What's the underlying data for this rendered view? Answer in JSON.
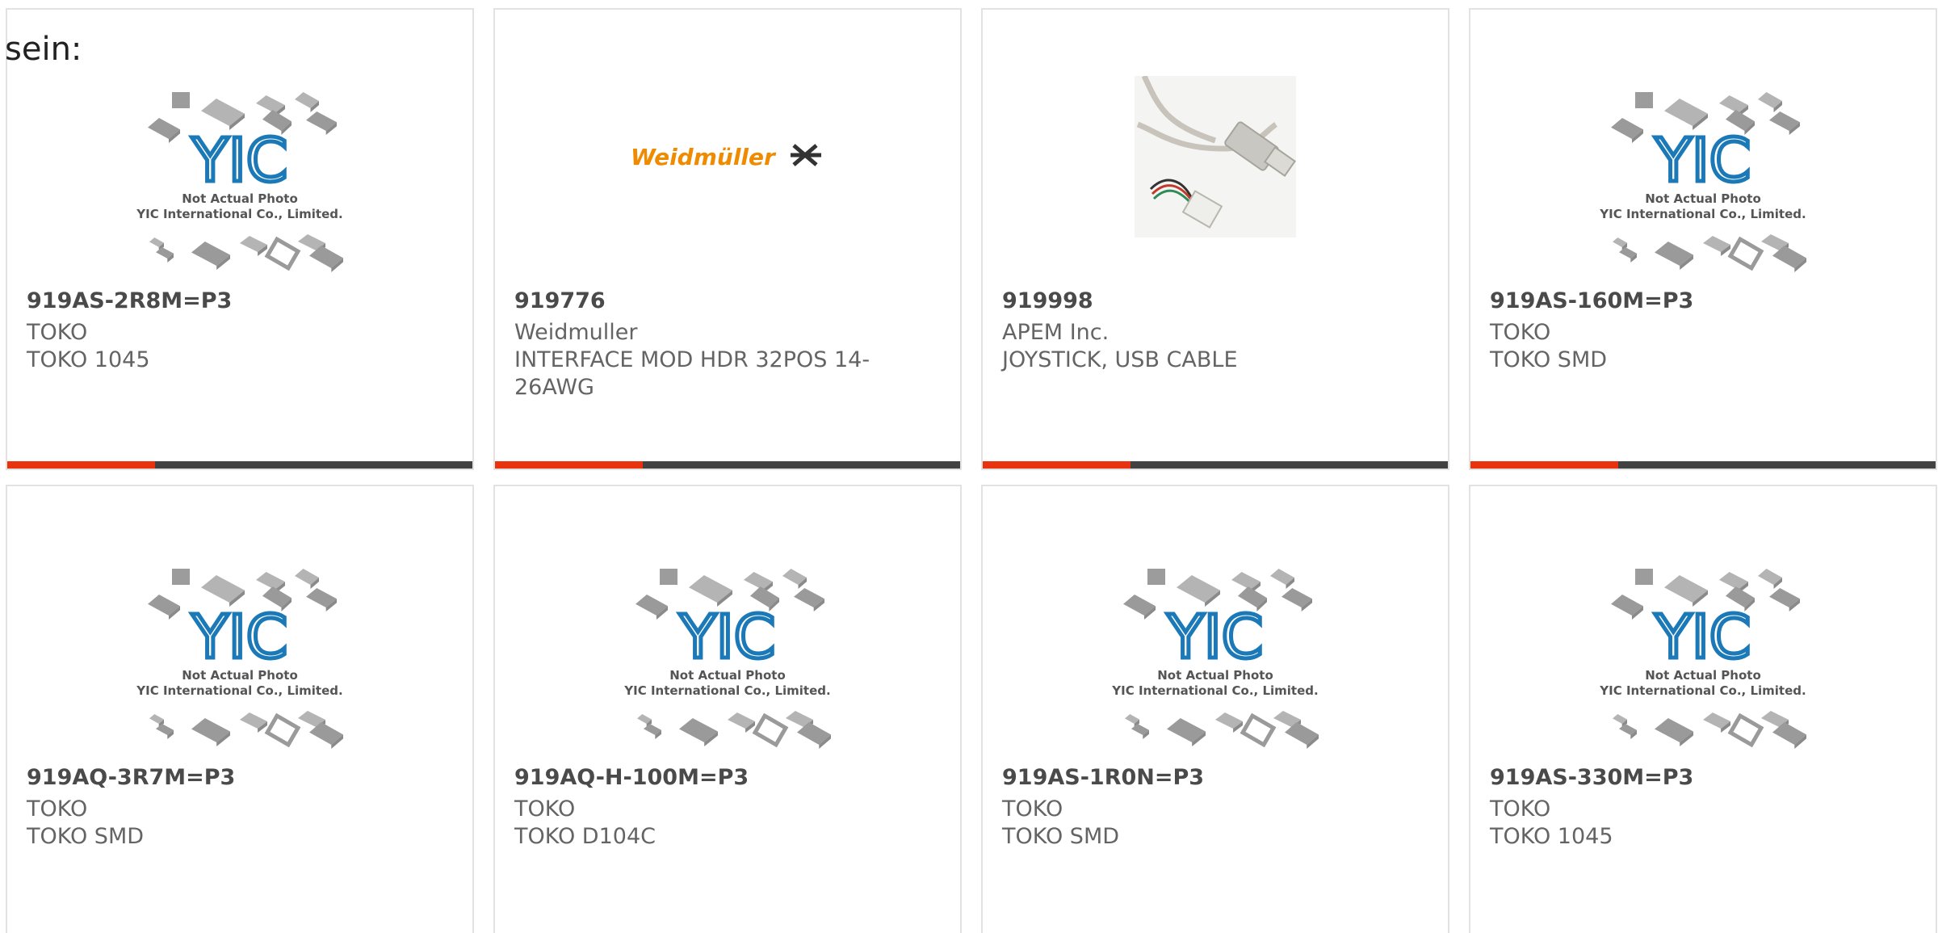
{
  "header_fragment": "sein:",
  "placeholder": {
    "brand": "YIC",
    "line1": "Not Actual Photo",
    "line2": "YIC International Co., Limited."
  },
  "weidmuller_logo_text": "Weidmüller",
  "colors": {
    "accent": "#e8330e",
    "bar": "#424242",
    "yic_blue": "#1b79b8",
    "weidmuller_orange": "#f08b00"
  },
  "products": [
    {
      "part": "919AS-2R8M=P3",
      "maker": "TOKO",
      "desc": "TOKO 1045",
      "image": "yic-placeholder"
    },
    {
      "part": "919776",
      "maker": "Weidmuller",
      "desc": "INTERFACE MOD HDR 32POS 14-26AWG",
      "image": "weidmuller-logo"
    },
    {
      "part": "919998",
      "maker": "APEM Inc.",
      "desc": "JOYSTICK, USB CABLE",
      "image": "usb-cable-photo"
    },
    {
      "part": "919AS-160M=P3",
      "maker": "TOKO",
      "desc": "TOKO SMD",
      "image": "yic-placeholder"
    },
    {
      "part": "919AQ-3R7M=P3",
      "maker": "TOKO",
      "desc": "TOKO SMD",
      "image": "yic-placeholder"
    },
    {
      "part": "919AQ-H-100M=P3",
      "maker": "TOKO",
      "desc": "TOKO D104C",
      "image": "yic-placeholder"
    },
    {
      "part": "919AS-1R0N=P3",
      "maker": "TOKO",
      "desc": "TOKO SMD",
      "image": "yic-placeholder"
    },
    {
      "part": "919AS-330M=P3",
      "maker": "TOKO",
      "desc": "TOKO 1045",
      "image": "yic-placeholder"
    }
  ]
}
